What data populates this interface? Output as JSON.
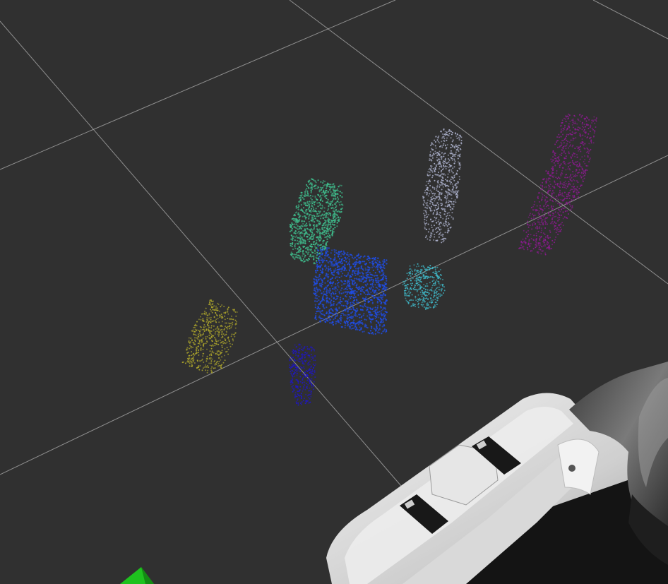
{
  "viewport": {
    "background": "#303030",
    "grid_color": "#a0a0a0"
  },
  "point_clouds": [
    {
      "name": "green-cluster",
      "color": "#3fb98a",
      "shape": "box"
    },
    {
      "name": "white-cluster",
      "color": "#a9aec8",
      "shape": "cylinder"
    },
    {
      "name": "purple-cluster",
      "color": "#8a1b8e",
      "shape": "slab"
    },
    {
      "name": "blue-cluster",
      "color": "#1f4de6",
      "shape": "box"
    },
    {
      "name": "cyan-cluster",
      "color": "#3fb5c4",
      "shape": "box"
    },
    {
      "name": "yellow-cluster",
      "color": "#a8a12c",
      "shape": "box"
    },
    {
      "name": "navy-cluster",
      "color": "#1f17c4",
      "shape": "cylinder"
    }
  ],
  "robot": {
    "body_color": "#e2e2e2",
    "shadow_color": "#8c8c8c",
    "dark_color": "#151515"
  },
  "marker": {
    "color": "#1ec21e"
  }
}
